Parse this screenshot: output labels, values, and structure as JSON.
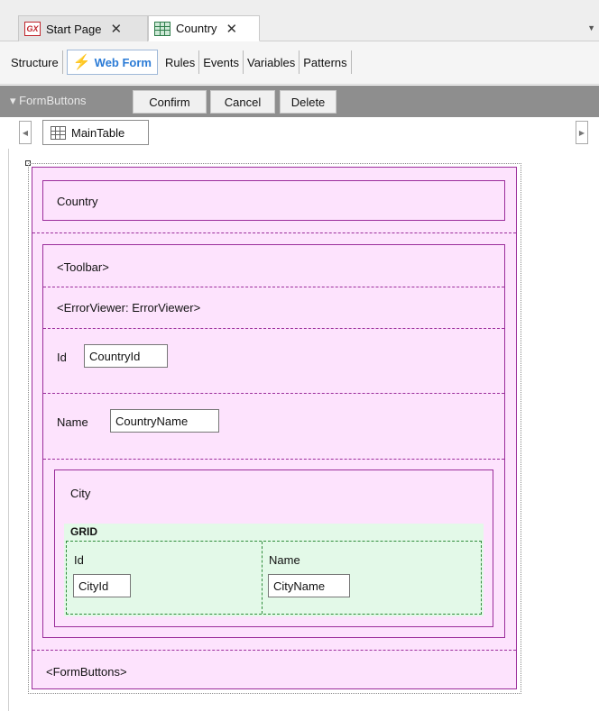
{
  "tabs": [
    {
      "label": "Start Page",
      "icon": "genexus-logo-icon",
      "active": false
    },
    {
      "label": "Country",
      "icon": "transaction-grid-icon",
      "active": true
    }
  ],
  "tab_close_glyph": "✕",
  "subtabs": {
    "items": [
      "Structure",
      "Web Form",
      "Rules",
      "Events",
      "Variables",
      "Patterns"
    ],
    "active": "Web Form"
  },
  "formbuttons_toolbar": {
    "label": "▾ FormButtons",
    "buttons": [
      "Confirm",
      "Cancel",
      "Delete"
    ]
  },
  "breadcrumb": {
    "table": "MainTable"
  },
  "form": {
    "title": "Country",
    "toolbar": "<Toolbar>",
    "error_viewer": "<ErrorViewer: ErrorViewer>",
    "id_label": "Id",
    "id_field": "CountryId",
    "name_label": "Name",
    "name_field": "CountryName",
    "city_title": "City",
    "grid": {
      "label": "GRID",
      "columns": [
        {
          "header": "Id",
          "field": "CityId"
        },
        {
          "header": "Name",
          "field": "CityName"
        }
      ]
    },
    "form_buttons": "<FormButtons>"
  },
  "colors": {
    "frame_border": "#9b2d9b",
    "frame_fill": "#fde3fd",
    "grid_fill": "#e3f9e8",
    "grid_border": "#2e8b3a",
    "active_tab_text": "#2b7bd6",
    "toolbar_bg": "#8e8e8e"
  }
}
